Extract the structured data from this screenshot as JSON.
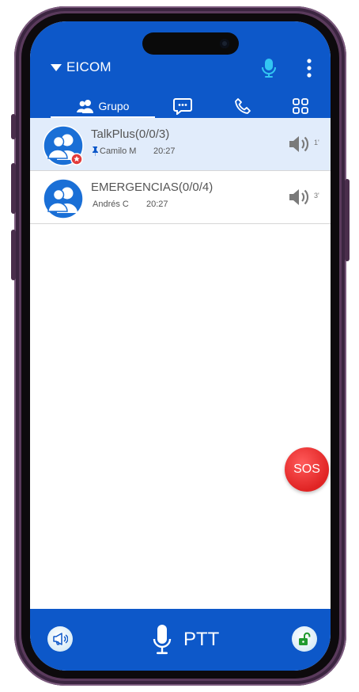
{
  "header": {
    "title": "EICOM"
  },
  "tabs": [
    {
      "label": "Grupo",
      "icon": "group-icon",
      "active": true
    },
    {
      "label": "",
      "icon": "chat-icon",
      "active": false
    },
    {
      "label": "",
      "icon": "phone-icon",
      "active": false
    },
    {
      "label": "",
      "icon": "apps-grid-icon",
      "active": false
    }
  ],
  "groups": [
    {
      "name": "TalkPlus(0/0/3)",
      "user": "Camilo M",
      "time": "20:27",
      "volume": "1'",
      "pinned": true,
      "selected": true
    },
    {
      "name": "EMERGENCIAS(0/0/4)",
      "user": "Andrés C",
      "time": "20:27",
      "volume": "3'",
      "pinned": false,
      "selected": false
    }
  ],
  "sos": {
    "label": "SOS"
  },
  "bottom": {
    "ptt_label": "PTT"
  },
  "colors": {
    "primary": "#0d58c9",
    "accent_mic": "#33c6f2",
    "sos": "#e02424",
    "selected_row": "#e1ecfb"
  }
}
